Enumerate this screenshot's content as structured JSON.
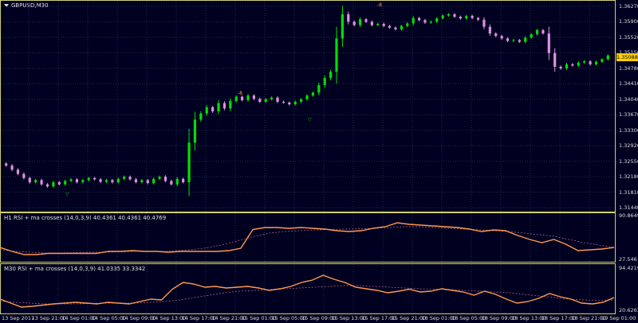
{
  "window": {
    "title": "GBPUSD,M30"
  },
  "main_axis": [
    "1.36270",
    "1.35900",
    "1.35520",
    "1.35150",
    "1.34780",
    "1.34410",
    "1.34040",
    "1.33670",
    "1.33300",
    "1.32920",
    "1.32550",
    "1.32180",
    "1.31810",
    "1.31440"
  ],
  "current_price": "1.35088",
  "fractal_labels": [
    "-8",
    "-8"
  ],
  "rsi1": {
    "label": "H1 RSI + ma crosses (14,0,3,9) 40.4361 40.4361 40.4769",
    "axis": [
      "90.8649",
      "27.546"
    ]
  },
  "rsi2": {
    "label": "M30 RSI + ma crosses (14,0,3,9) 41.0335 33.3342",
    "axis": [
      "94.4219",
      "20.6263"
    ]
  },
  "time_axis": [
    "13 Sep 2017",
    "13 Sep 21:00",
    "14 Sep 01:00",
    "14 Sep 05:00",
    "14 Sep 09:00",
    "14 Sep 13:00",
    "14 Sep 17:00",
    "14 Sep 21:00",
    "15 Sep 01:00",
    "15 Sep 05:00",
    "15 Sep 09:00",
    "15 Sep 13:00",
    "15 Sep 17:00",
    "15 Sep 21:00",
    "18 Sep 01:00",
    "18 Sep 05:00",
    "18 Sep 09:00",
    "18 Sep 13:00",
    "18 Sep 17:00",
    "18 Sep 21:00",
    "19 Sep 01:00"
  ],
  "colors": {
    "bull": "#00e000",
    "bear": "#e090e0",
    "grid": "#27275a",
    "rsi": "#00e000",
    "ma": "#ff9a50",
    "signal": "#b06080",
    "frame": "#cfcf70"
  },
  "chart_data": {
    "type": "candlestick",
    "symbol": "GBPUSD",
    "timeframe": "M30",
    "ylim": [
      1.3144,
      1.3627
    ],
    "closes": [
      1.3245,
      1.3235,
      1.3225,
      1.3215,
      1.3205,
      1.321,
      1.32,
      1.3195,
      1.3205,
      1.32,
      1.3208,
      1.3212,
      1.3205,
      1.321,
      1.3215,
      1.3212,
      1.3206,
      1.321,
      1.3205,
      1.3213,
      1.3218,
      1.3212,
      1.3205,
      1.321,
      1.3203,
      1.3213,
      1.3218,
      1.3208,
      1.32,
      1.3213,
      1.3205,
      1.33,
      1.3355,
      1.337,
      1.3385,
      1.3375,
      1.3395,
      1.3382,
      1.34,
      1.341,
      1.3402,
      1.3413,
      1.3405,
      1.3398,
      1.3404,
      1.3408,
      1.3398,
      1.3396,
      1.3392,
      1.3398,
      1.3404,
      1.3413,
      1.342,
      1.3438,
      1.3455,
      1.347,
      1.355,
      1.3608,
      1.359,
      1.3582,
      1.3596,
      1.359,
      1.3582,
      1.3585,
      1.358,
      1.3576,
      1.3572,
      1.358,
      1.3586,
      1.3599,
      1.3594,
      1.3588,
      1.359,
      1.3598,
      1.3605,
      1.3608,
      1.3602,
      1.3598,
      1.3604,
      1.3599,
      1.3595,
      1.3578,
      1.3562,
      1.3556,
      1.355,
      1.3544,
      1.3546,
      1.3542,
      1.3552,
      1.356,
      1.357,
      1.3562,
      1.3515,
      1.3482,
      1.3478,
      1.3488,
      1.3485,
      1.3492,
      1.3495,
      1.3488,
      1.3494,
      1.35,
      1.3509
    ]
  }
}
